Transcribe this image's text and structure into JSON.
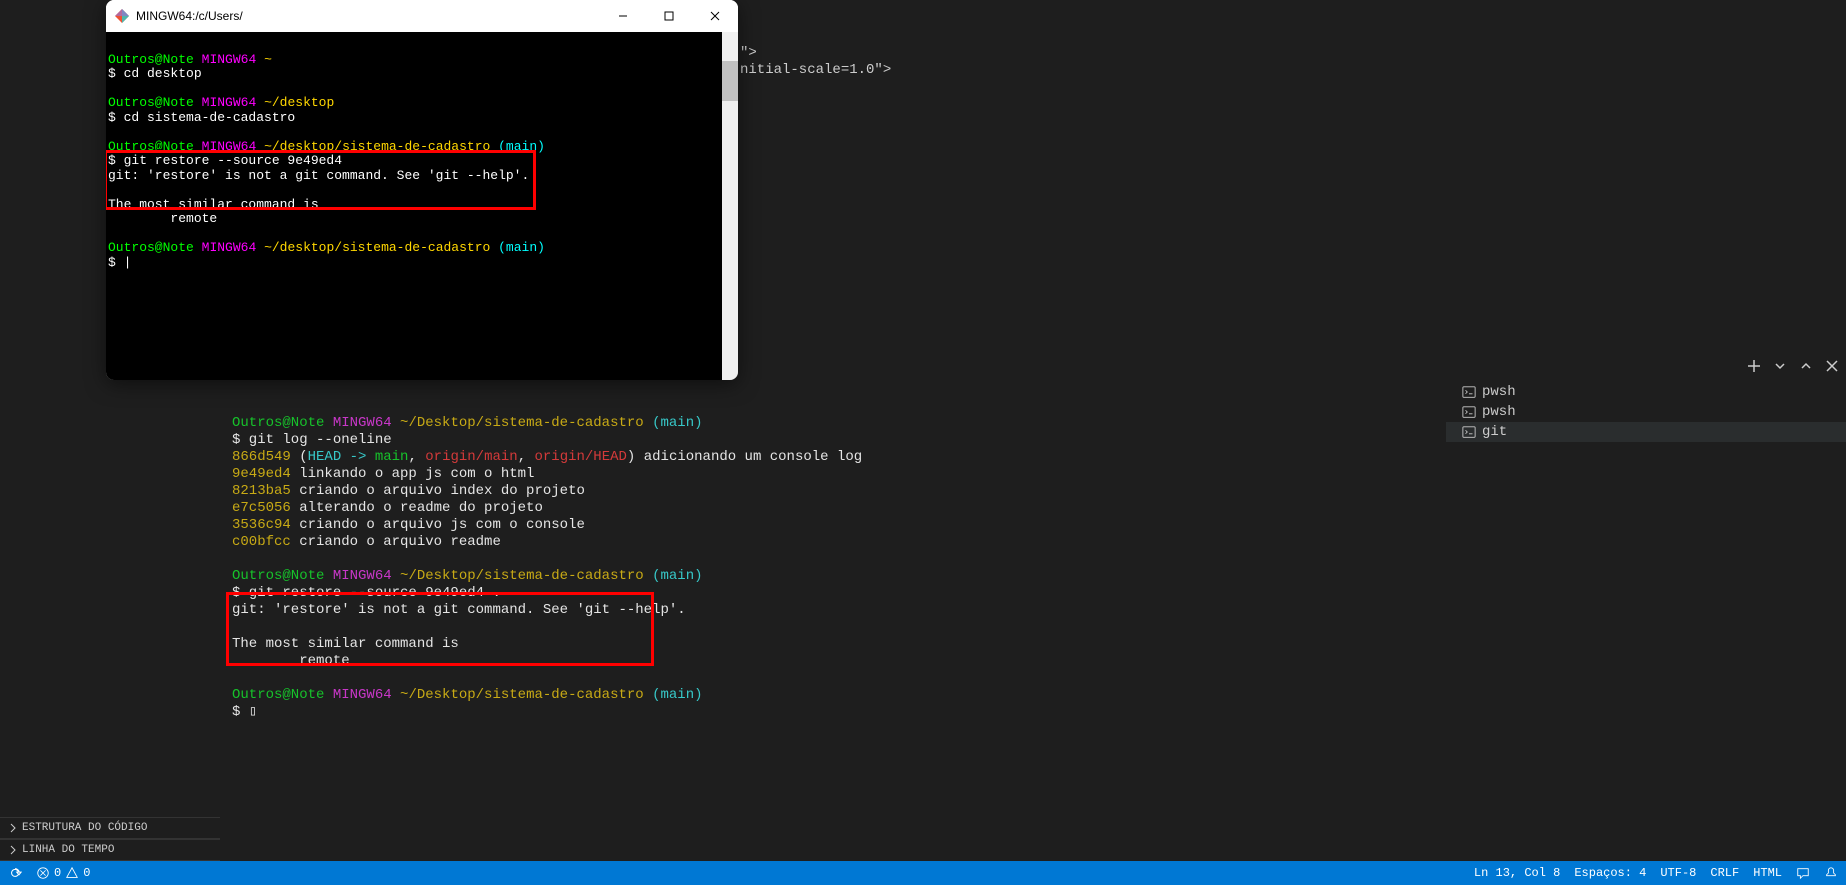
{
  "mingw": {
    "title": "MINGW64:/c/Users/",
    "lines": {
      "l1_user": "Outros@Note",
      "l1_host": "MINGW64",
      "l1_path": "~",
      "l2_cmd": "$ cd desktop",
      "l3_user": "Outros@Note",
      "l3_host": "MINGW64",
      "l3_path": "~/desktop",
      "l4_cmd": "$ cd sistema-de-cadastro",
      "l5_user": "Outros@Note",
      "l5_host": "MINGW64",
      "l5_path": "~/desktop/sistema-de-cadastro",
      "l5_branch": "(main)",
      "l6_cmd": "$ git restore --source 9e49ed4",
      "l7_err": "git: 'restore' is not a git command. See 'git --help'.",
      "l8_blank": "",
      "l9_msg": "The most similar command is",
      "l10_msg": "        remote",
      "l11_user": "Outros@Note",
      "l11_host": "MINGW64",
      "l11_path": "~/desktop/sistema-de-cadastro",
      "l11_branch": "(main)",
      "l12_prompt": "$ "
    }
  },
  "editor": {
    "line1": "\">",
    "line2": "nitial-scale=1.0\">"
  },
  "vscode_terminal": {
    "p1_user": "Outros@Note",
    "p1_host": "MINGW64",
    "p1_path": "~/Desktop/sistema-de-cadastro",
    "p1_branch": "(main)",
    "cmd1": "$ git log --oneline",
    "log": [
      {
        "hash": "866d549",
        "refs": "(HEAD -> main, origin/main, origin/HEAD)",
        "msg": "adicionando um console log"
      },
      {
        "hash": "9e49ed4",
        "msg": "linkando o app js com o html"
      },
      {
        "hash": "8213ba5",
        "msg": "criando o arquivo index do projeto"
      },
      {
        "hash": "e7c5056",
        "msg": "alterando o readme do projeto"
      },
      {
        "hash": "3536c94",
        "msg": "criando o arquivo js com o console"
      },
      {
        "hash": "c00bfcc",
        "msg": "criando o arquivo readme"
      }
    ],
    "p2_user": "Outros@Note",
    "p2_host": "MINGW64",
    "p2_path": "~/Desktop/sistema-de-cadastro",
    "p2_branch": "(main)",
    "cmd2": "$ git restore --source 9e49ed4 .",
    "err1": "git: 'restore' is not a git command. See 'git --help'.",
    "err2": "",
    "err3": "The most similar command is",
    "err4": "        remote",
    "p3_user": "Outros@Note",
    "p3_host": "MINGW64",
    "p3_path": "~/Desktop/sistema-de-cadastro",
    "p3_branch": "(main)",
    "cmd3": "$ ▯",
    "refs_head": "HEAD -> ",
    "refs_main": "main",
    "refs_comma1": ", ",
    "refs_origin_main": "origin/main",
    "refs_comma2": ", ",
    "refs_origin_head": "origin/HEAD"
  },
  "term_tabs": {
    "t1": "pwsh",
    "t2": "pwsh",
    "t3": "git"
  },
  "outline": {
    "h1": "ESTRUTURA DO CÓDIGO",
    "h2": "LINHA DO TEMPO"
  },
  "statusbar": {
    "errors": "0",
    "warnings": "0",
    "ln_col": "Ln 13, Col 8",
    "spaces": "Espaços: 4",
    "encoding": "UTF-8",
    "eol": "CRLF",
    "lang": "HTML"
  }
}
